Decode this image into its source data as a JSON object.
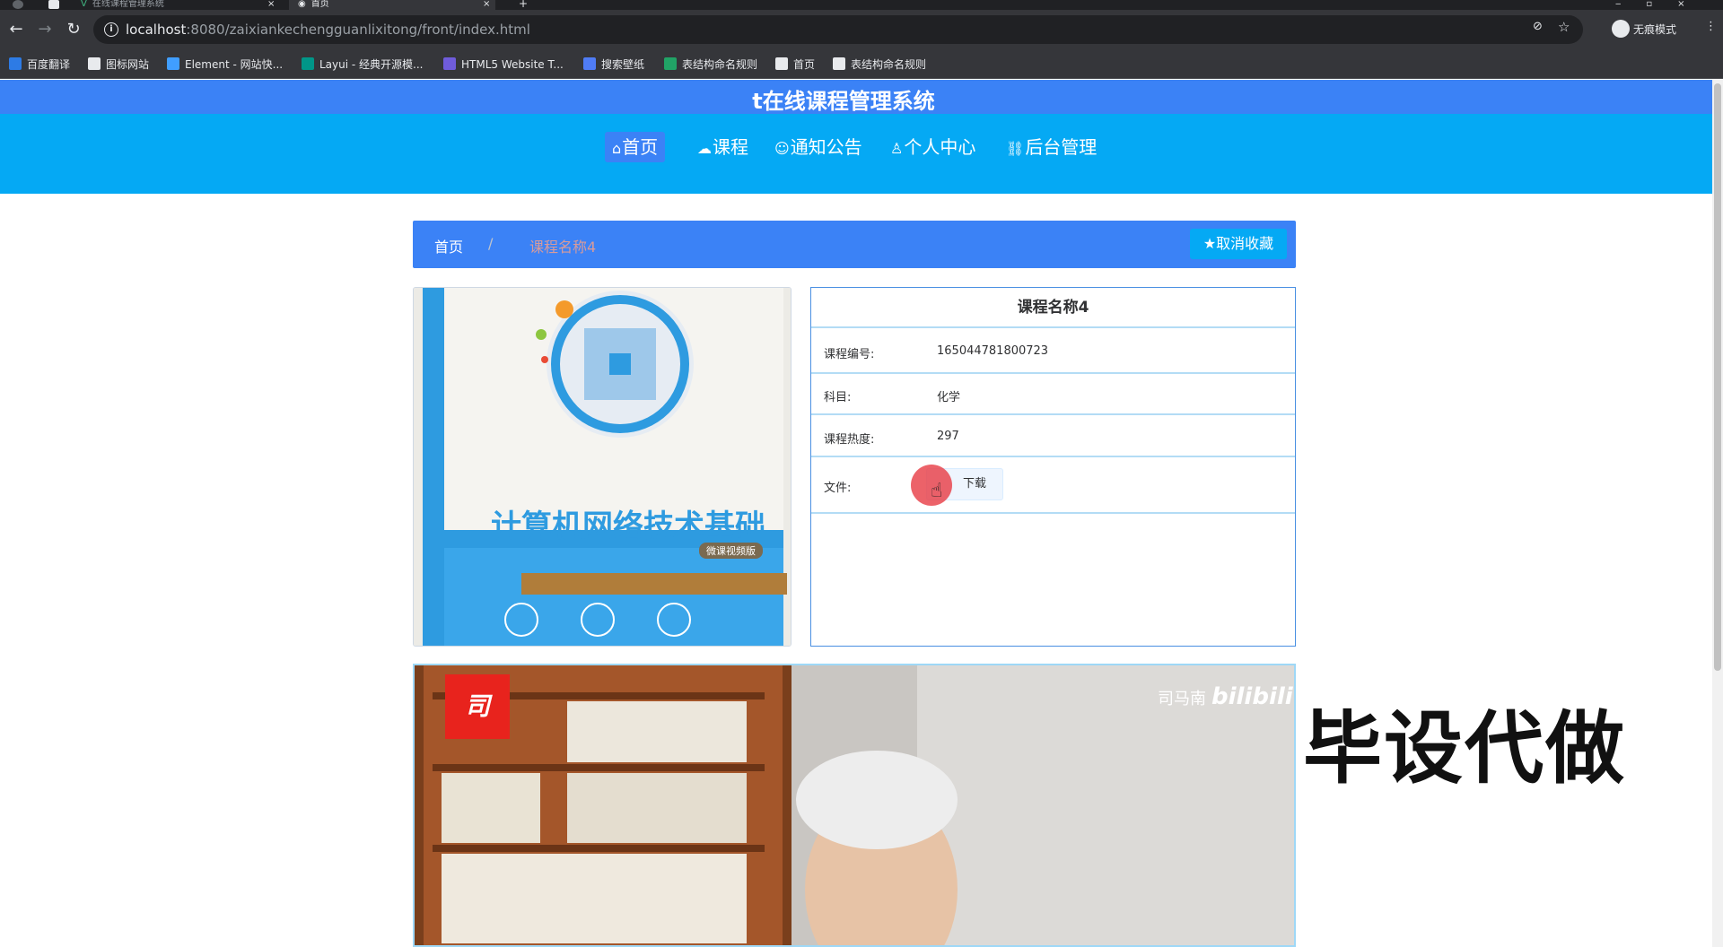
{
  "browser": {
    "tabs": [
      {
        "title": "在线课程管理系统"
      },
      {
        "title": "首页"
      }
    ],
    "url_host": "localhost",
    "url_path": ":8080/zaixiankechengguanlixitong/front/index.html",
    "incognito_label": "无痕模式",
    "bookmarks": [
      {
        "label": "百度翻译",
        "icon": "baidu-translate-icon",
        "color": "#2d7be5"
      },
      {
        "label": "图标网站",
        "icon": "flag-icon",
        "color": "#e8eaed"
      },
      {
        "label": "Element - 网站快...",
        "icon": "element-icon",
        "color": "#409eff"
      },
      {
        "label": "Layui - 经典开源模...",
        "icon": "layui-icon",
        "color": "#009688"
      },
      {
        "label": "HTML5 Website T...",
        "icon": "html5-icon",
        "color": "#6f5cdb"
      },
      {
        "label": "搜索壁纸",
        "icon": "wallpaper-icon",
        "color": "#4f7cf5"
      },
      {
        "label": "表结构命名规则",
        "icon": "sheet-icon",
        "color": "#21a366"
      },
      {
        "label": "首页",
        "icon": "globe-icon",
        "color": "#e8eaed"
      },
      {
        "label": "表结构命名规则",
        "icon": "globe-icon",
        "color": "#e8eaed"
      }
    ]
  },
  "site": {
    "title": "t在线课程管理系统",
    "nav": [
      {
        "icon": "⌂",
        "label": "首页",
        "active": true
      },
      {
        "icon": "☁",
        "label": "课程",
        "active": false
      },
      {
        "icon": "☺",
        "label": "通知公告",
        "active": false
      },
      {
        "icon": "♙",
        "label": "个人中心",
        "active": false
      },
      {
        "icon": "⛓",
        "label": "后台管理",
        "active": false
      }
    ]
  },
  "breadcrumb": {
    "home": "首页",
    "separator": "/",
    "current": "课程名称4"
  },
  "favorite_button": {
    "label": "取消收藏"
  },
  "course": {
    "cover_title": "计算机网络技术基础",
    "cover_subtitle": "微课视频版",
    "name": "课程名称4",
    "rows": [
      {
        "label": "课程编号:",
        "value": "165044781800723"
      },
      {
        "label": "科目:",
        "value": "化学"
      },
      {
        "label": "课程热度:",
        "value": "297"
      }
    ],
    "file_label": "文件:",
    "download_label": "下载"
  },
  "video": {
    "logo_char": "司",
    "watermark_name": "司马南",
    "watermark_brand": "bilibili"
  },
  "overlay_text": "毕设代做",
  "colors": {
    "header_blue": "#3b82f6",
    "nav_cyan": "#05a9f4"
  }
}
